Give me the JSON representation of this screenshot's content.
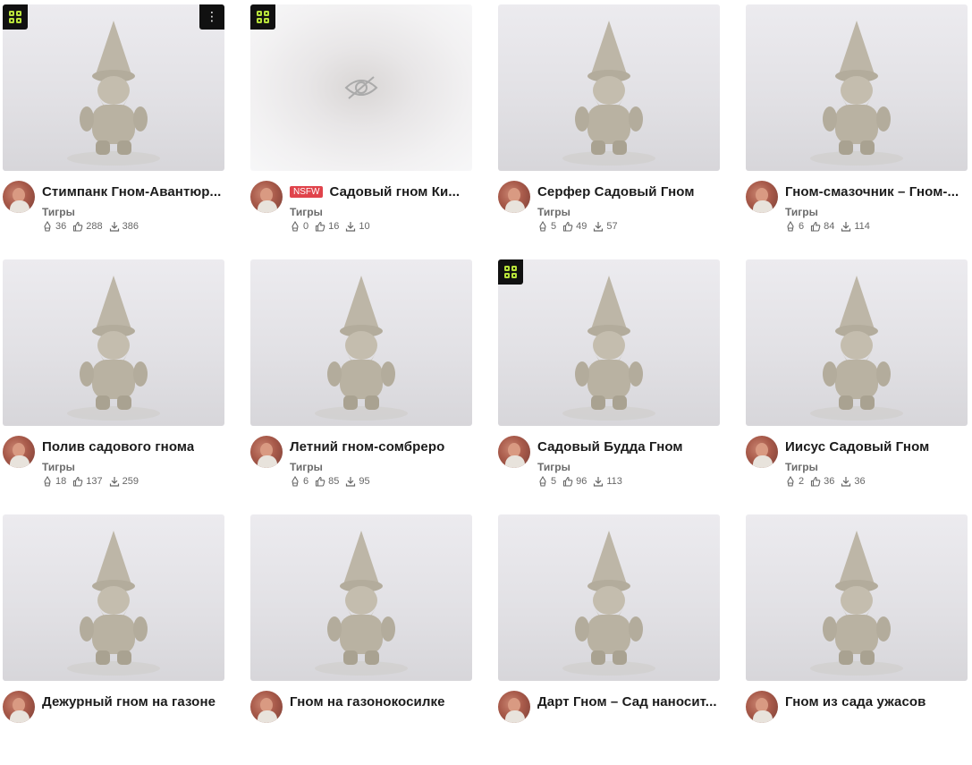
{
  "colors": {
    "nsfw_bg": "#e0434b",
    "badge_bg": "#111111",
    "badge_accent": "#b8e23a",
    "title": "#1b1b1b",
    "meta": "#666666"
  },
  "cards": [
    {
      "title": "Стимпанк Гном-Авантюр...",
      "author": "Тигры",
      "makes": "36",
      "likes": "288",
      "downloads": "386",
      "badge": true,
      "menu": "⋮",
      "nsfw": "",
      "blurred": false
    },
    {
      "title": "Садовый гном Ки...",
      "author": "Тигры",
      "makes": "0",
      "likes": "16",
      "downloads": "10",
      "badge": true,
      "menu": "",
      "nsfw": "NSFW",
      "blurred": true
    },
    {
      "title": "Серфер Садовый Гном",
      "author": "Тигры",
      "makes": "5",
      "likes": "49",
      "downloads": "57",
      "badge": false,
      "menu": "",
      "nsfw": "",
      "blurred": false
    },
    {
      "title": "Гном-смазочник – Гном-...",
      "author": "Тигры",
      "makes": "6",
      "likes": "84",
      "downloads": "114",
      "badge": false,
      "menu": "",
      "nsfw": "",
      "blurred": false
    },
    {
      "title": "Полив садового гнома",
      "author": "Тигры",
      "makes": "18",
      "likes": "137",
      "downloads": "259",
      "badge": false,
      "menu": "",
      "nsfw": "",
      "blurred": false
    },
    {
      "title": "Летний гном-сомбреро",
      "author": "Тигры",
      "makes": "6",
      "likes": "85",
      "downloads": "95",
      "badge": false,
      "menu": "",
      "nsfw": "",
      "blurred": false
    },
    {
      "title": "Садовый Будда Гном",
      "author": "Тигры",
      "makes": "5",
      "likes": "96",
      "downloads": "113",
      "badge": true,
      "menu": "",
      "nsfw": "",
      "blurred": false
    },
    {
      "title": "Иисус Садовый Гном",
      "author": "Тигры",
      "makes": "2",
      "likes": "36",
      "downloads": "36",
      "badge": false,
      "menu": "",
      "nsfw": "",
      "blurred": false
    },
    {
      "title": "Дежурный гном на газоне",
      "author": "",
      "makes": "",
      "likes": "",
      "downloads": "",
      "badge": false,
      "menu": "",
      "nsfw": "",
      "blurred": false
    },
    {
      "title": "Гном на газонокосилке",
      "author": "",
      "makes": "",
      "likes": "",
      "downloads": "",
      "badge": false,
      "menu": "",
      "nsfw": "",
      "blurred": false
    },
    {
      "title": "Дарт Гном – Сад наносит...",
      "author": "",
      "makes": "",
      "likes": "",
      "downloads": "",
      "badge": false,
      "menu": "",
      "nsfw": "",
      "blurred": false
    },
    {
      "title": "Гном из сада ужасов",
      "author": "",
      "makes": "",
      "likes": "",
      "downloads": "",
      "badge": false,
      "menu": "",
      "nsfw": "",
      "blurred": false
    }
  ]
}
